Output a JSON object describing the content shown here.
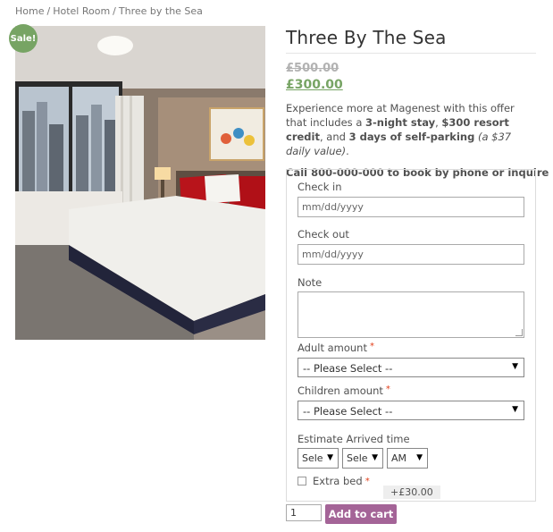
{
  "breadcrumb": {
    "items": [
      "Home",
      "Hotel Room",
      "Three by the Sea"
    ],
    "separator": "/"
  },
  "product": {
    "badge": "Sale!",
    "title": "Three By The Sea",
    "price_old": "£500.00",
    "price_new": "£300.00",
    "description": {
      "p1": "Experience more at Magenest with this offer that includes a ",
      "b1": "3-night stay",
      "p2": ", ",
      "b2": "$300 resort credit",
      "p3": ", and ",
      "b3": "3 days of self-parking",
      "p4": " ",
      "i1": "(a $37 daily value)",
      "p5": "."
    },
    "call_text": "Call 800-000-000 to book by phone or inquire"
  },
  "form": {
    "check_in_label": "Check in",
    "check_in_placeholder": "mm/dd/yyyy",
    "check_out_label": "Check out",
    "check_out_placeholder": "mm/dd/yyyy",
    "note_label": "Note",
    "adult_label": "Adult amount",
    "adult_value": "-- Please Select --",
    "children_label": "Children amount",
    "children_value": "-- Please Select --",
    "arrival_label": "Estimate Arrived time",
    "hour_value": "Sele",
    "minute_value": "Sele",
    "ampm_value": "AM",
    "required_mark": "*",
    "extra_bed_label": "Extra bed",
    "extra_bed_price": "+£30.00"
  },
  "cart": {
    "quantity": "1",
    "add_label": "Add to cart"
  },
  "colors": {
    "sale_green": "#77a464",
    "button_purple": "#a46497",
    "required_red": "#e2401c"
  }
}
